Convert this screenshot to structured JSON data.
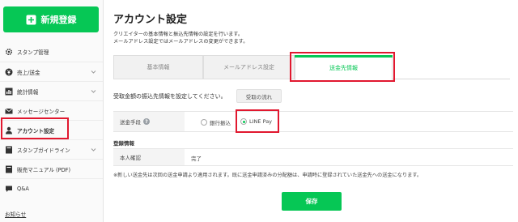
{
  "sidebar": {
    "new_button_label": "新規登録",
    "items": [
      {
        "label": "スタンプ管理",
        "icon": "gear-icon"
      },
      {
        "label": "売上/送金",
        "icon": "yen-icon",
        "expandable": true
      },
      {
        "label": "統計情報",
        "icon": "bar-chart-icon",
        "expandable": true
      },
      {
        "label": "メッセージセンター",
        "icon": "mail-icon"
      },
      {
        "label": "アカウント設定",
        "icon": "person-icon",
        "active": true
      },
      {
        "label": "スタンプガイドライン",
        "icon": "book-icon",
        "expandable": true
      },
      {
        "label": "販売マニュアル (PDF)",
        "icon": "book-icon"
      },
      {
        "label": "Q&A",
        "icon": "chat-icon"
      }
    ],
    "notice_link": "お知らせ"
  },
  "main": {
    "title": "アカウント設定",
    "description_line1": "クリエイターの基本情報と振込先情報の設定を行います。",
    "description_line2": "メールアドレス設定ではメールアドレスの変更ができます。",
    "tabs": [
      {
        "label": "基本情報"
      },
      {
        "label": "メールアドレス設定"
      },
      {
        "label": "送金先情報",
        "active": true
      }
    ],
    "instruction": "受取金額の振込先情報を設定してください。",
    "flow_button": "受取の流れ",
    "method_label": "送金手段",
    "method_options": [
      {
        "label": "銀行振込",
        "checked": false
      },
      {
        "label": "LINE Pay",
        "checked": true
      }
    ],
    "section_title": "登録情報",
    "verify_label": "本人確認",
    "verify_value": "完了",
    "footnote": "※新しい送金先は次回の送金申請より適用されます。既に送金申請済みの分配額は、申請時に登録されていた送金先への送金になります。",
    "save_button": "保存"
  },
  "colors": {
    "accent": "#06c755",
    "highlight": "#e1182f"
  }
}
